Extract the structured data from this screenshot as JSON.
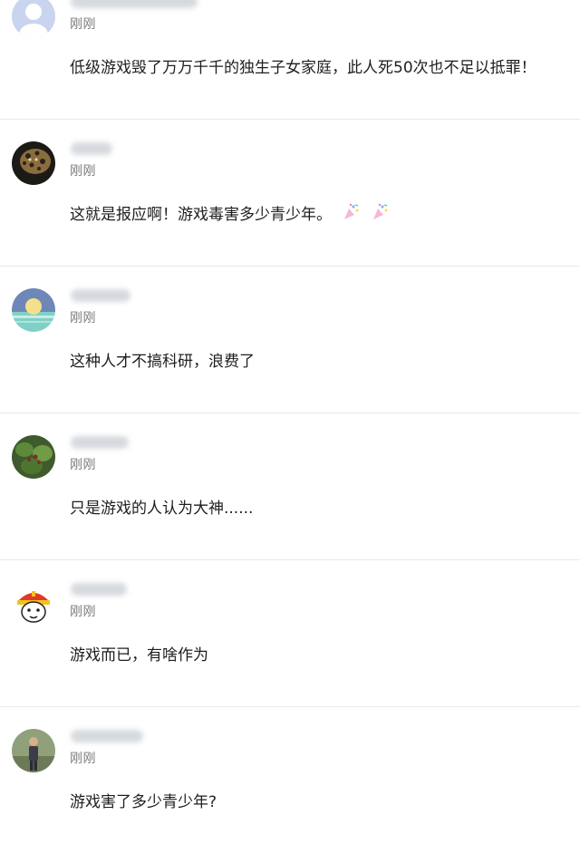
{
  "comments": [
    {
      "time": "刚刚",
      "text": "低级游戏毁了万万千千的独生子女家庭，此人死50次也不足以抵罪！",
      "avatar": "default-user-avatar",
      "username_blurred": true
    },
    {
      "time": "刚刚",
      "text": "这就是报应啊！游戏毒害多少青少年。",
      "avatar": "leopard-avatar",
      "username_blurred": true,
      "emojis": [
        "party-popper-icon",
        "party-popper-icon"
      ]
    },
    {
      "time": "刚刚",
      "text": "这种人才不搞科研，浪费了",
      "avatar": "sunset-sea-avatar",
      "username_blurred": true
    },
    {
      "time": "刚刚",
      "text": "只是游戏的人认为大神......",
      "avatar": "plant-avatar",
      "username_blurred": true
    },
    {
      "time": "刚刚",
      "text": "游戏而已，有啥作为",
      "avatar": "cartoon-firefighter-avatar",
      "username_blurred": true
    },
    {
      "time": "刚刚",
      "text": "游戏害了多少青少年?",
      "avatar": "person-outdoor-avatar",
      "username_blurred": true
    }
  ],
  "colors": {
    "time": "#7a7a7a",
    "text": "#1e1e1e",
    "divider": "#e9e9e9"
  }
}
